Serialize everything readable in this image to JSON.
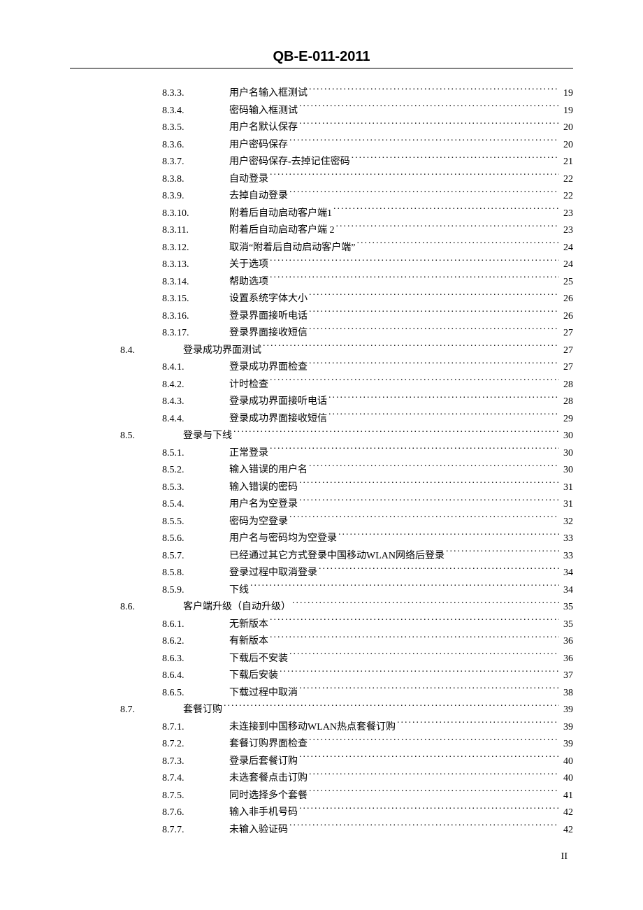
{
  "header": "QB-E-011-2011",
  "page_number": "II",
  "toc": [
    {
      "level": 3,
      "num": "8.3.3.",
      "text": "用户名输入框测试",
      "page": "19"
    },
    {
      "level": 3,
      "num": "8.3.4.",
      "text": "密码输入框测试",
      "page": "19"
    },
    {
      "level": 3,
      "num": "8.3.5.",
      "text": "用户名默认保存",
      "page": "20"
    },
    {
      "level": 3,
      "num": "8.3.6.",
      "text": "用户密码保存",
      "page": "20"
    },
    {
      "level": 3,
      "num": "8.3.7.",
      "text": "用户密码保存-去掉记住密码",
      "page": "21"
    },
    {
      "level": 3,
      "num": "8.3.8.",
      "text": "自动登录",
      "page": "22"
    },
    {
      "level": 3,
      "num": "8.3.9.",
      "text": "去掉自动登录",
      "page": "22"
    },
    {
      "level": 3,
      "num": "8.3.10.",
      "text": "附着后自动启动客户端1",
      "page": "23"
    },
    {
      "level": 3,
      "num": "8.3.11.",
      "text": "附着后自动启动客户端 2",
      "page": "23"
    },
    {
      "level": 3,
      "num": "8.3.12.",
      "text": "取消“附着后自动启动客户端”",
      "page": "24"
    },
    {
      "level": 3,
      "num": "8.3.13.",
      "text": "关于选项",
      "page": "24"
    },
    {
      "level": 3,
      "num": "8.3.14.",
      "text": "帮助选项",
      "page": "25"
    },
    {
      "level": 3,
      "num": "8.3.15.",
      "text": "设置系统字体大小",
      "page": "26"
    },
    {
      "level": 3,
      "num": "8.3.16.",
      "text": "登录界面接听电话",
      "page": "26"
    },
    {
      "level": 3,
      "num": "8.3.17.",
      "text": "登录界面接收短信",
      "page": "27"
    },
    {
      "level": 2,
      "num": "8.4.",
      "text": "登录成功界面测试",
      "page": "27"
    },
    {
      "level": 3,
      "num": "8.4.1.",
      "text": "登录成功界面检查",
      "page": "27"
    },
    {
      "level": 3,
      "num": "8.4.2.",
      "text": "计时检查",
      "page": "28"
    },
    {
      "level": 3,
      "num": "8.4.3.",
      "text": "登录成功界面接听电话",
      "page": "28"
    },
    {
      "level": 3,
      "num": "8.4.4.",
      "text": "登录成功界面接收短信",
      "page": "29"
    },
    {
      "level": 2,
      "num": "8.5.",
      "text": "登录与下线",
      "page": "30"
    },
    {
      "level": 3,
      "num": "8.5.1.",
      "text": "正常登录",
      "page": "30"
    },
    {
      "level": 3,
      "num": "8.5.2.",
      "text": "输入错误的用户名",
      "page": "30"
    },
    {
      "level": 3,
      "num": "8.5.3.",
      "text": "输入错误的密码",
      "page": "31"
    },
    {
      "level": 3,
      "num": "8.5.4.",
      "text": "用户名为空登录",
      "page": "31"
    },
    {
      "level": 3,
      "num": "8.5.5.",
      "text": "密码为空登录",
      "page": "32"
    },
    {
      "level": 3,
      "num": "8.5.6.",
      "text": "用户名与密码均为空登录",
      "page": "33"
    },
    {
      "level": 3,
      "num": "8.5.7.",
      "text": "已经通过其它方式登录中国移动WLAN网络后登录",
      "page": "33"
    },
    {
      "level": 3,
      "num": "8.5.8.",
      "text": "登录过程中取消登录",
      "page": "34"
    },
    {
      "level": 3,
      "num": "8.5.9.",
      "text": "下线",
      "page": "34"
    },
    {
      "level": 2,
      "num": "8.6.",
      "text": "客户端升级（自动升级）",
      "page": "35"
    },
    {
      "level": 3,
      "num": "8.6.1.",
      "text": "无新版本",
      "page": "35"
    },
    {
      "level": 3,
      "num": "8.6.2.",
      "text": "有新版本",
      "page": "36"
    },
    {
      "level": 3,
      "num": "8.6.3.",
      "text": "下载后不安装",
      "page": "36"
    },
    {
      "level": 3,
      "num": "8.6.4.",
      "text": "下载后安装",
      "page": "37"
    },
    {
      "level": 3,
      "num": "8.6.5.",
      "text": "下载过程中取消",
      "page": "38"
    },
    {
      "level": 2,
      "num": "8.7.",
      "text": "套餐订购",
      "page": "39"
    },
    {
      "level": 3,
      "num": "8.7.1.",
      "text": "未连接到中国移动WLAN热点套餐订购",
      "page": "39"
    },
    {
      "level": 3,
      "num": "8.7.2.",
      "text": "套餐订购界面检查",
      "page": "39"
    },
    {
      "level": 3,
      "num": "8.7.3.",
      "text": "登录后套餐订购",
      "page": "40"
    },
    {
      "level": 3,
      "num": "8.7.4.",
      "text": "未选套餐点击订购",
      "page": "40"
    },
    {
      "level": 3,
      "num": "8.7.5.",
      "text": "同时选择多个套餐",
      "page": "41"
    },
    {
      "level": 3,
      "num": "8.7.6.",
      "text": "输入非手机号码",
      "page": "42"
    },
    {
      "level": 3,
      "num": "8.7.7.",
      "text": "未输入验证码",
      "page": "42"
    }
  ]
}
